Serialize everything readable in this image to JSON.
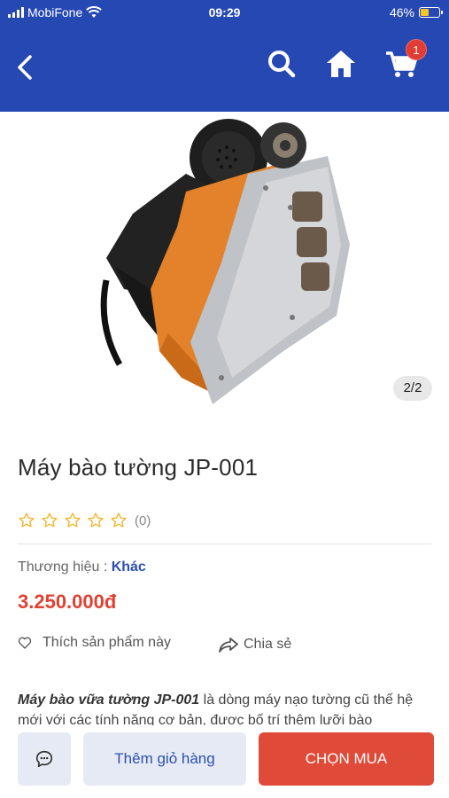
{
  "status_bar": {
    "carrier": "MobiFone",
    "time": "09:29",
    "battery_text": "46%"
  },
  "header": {
    "back_icon": "chevron-left-icon",
    "search_icon": "search-icon",
    "home_icon": "home-icon",
    "cart_icon": "cart-icon",
    "cart_badge": "1",
    "bg_color": "#2648b3"
  },
  "gallery": {
    "counter": "2/2"
  },
  "product": {
    "title": "Máy bào tường JP-001",
    "rating_count": "(0)",
    "brand_label": "Thương hiệu : ",
    "brand_value": "Khác",
    "price": "3.250.000đ",
    "price_color": "#e04132"
  },
  "actions": {
    "like_label": "Thích sản phẩm này",
    "share_label": "Chia sẻ"
  },
  "description": {
    "lead": "Máy bào vữa tường JP-001",
    "text": " là dòng máy nạo tường cũ thế hệ mới với các tính năng cơ bản, được bố trí thêm lưỡi bào"
  },
  "bottom_bar": {
    "chat_icon": "chat-icon",
    "add_to_cart_label": "Thêm giỏ hàng",
    "buy_label": "CHỌN MUA",
    "buy_color": "#e04a38"
  }
}
